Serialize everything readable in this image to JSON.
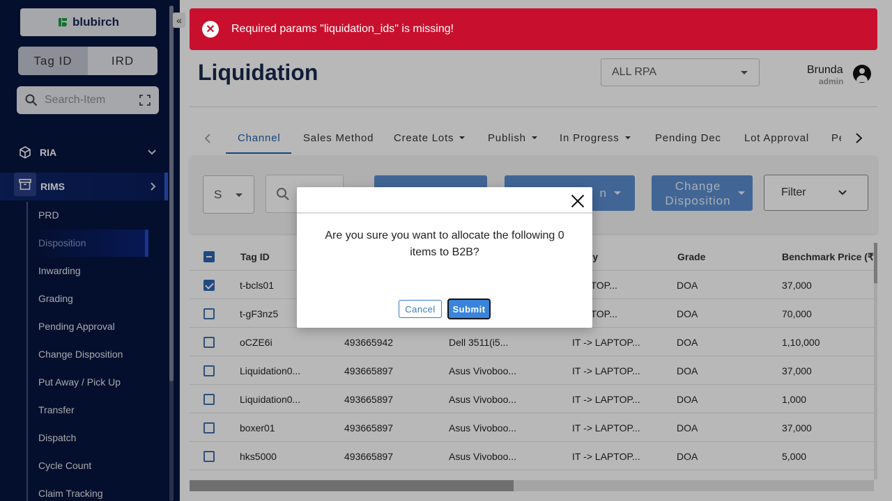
{
  "sidebar": {
    "logo_text": "blubirch",
    "toggle": {
      "option1": "Tag ID",
      "option2": "IRD"
    },
    "search_placeholder": "Search-Item",
    "sections": [
      {
        "label": "RIA"
      },
      {
        "label": "RIMS"
      }
    ],
    "sub_items": [
      "PRD",
      "Disposition",
      "Inwarding",
      "Grading",
      "Pending Approval",
      "Change Disposition",
      "Put Away / Pick Up",
      "Transfer",
      "Dispatch",
      "Cycle Count",
      "Claim Tracking"
    ],
    "active_item": "Disposition",
    "collapse_glyph": "«"
  },
  "alert": {
    "message": "Required params \"liquidation_ids\" is missing!",
    "icon": "error-circle-icon",
    "color": "#c8102e"
  },
  "header": {
    "title": "Liquidation",
    "rpa_select_value": "ALL RPA",
    "user_name": "Brunda",
    "user_role": "admin"
  },
  "tabs": {
    "items": [
      {
        "label": "Channel",
        "dropdown": false,
        "active": true
      },
      {
        "label": "Sales Method",
        "dropdown": false
      },
      {
        "label": "Create Lots",
        "dropdown": true
      },
      {
        "label": "Publish",
        "dropdown": true
      },
      {
        "label": "In Progress",
        "dropdown": true
      },
      {
        "label": "Pending Dec",
        "dropdown": false
      },
      {
        "label": "Lot Approval",
        "dropdown": false
      },
      {
        "label": "Pe",
        "dropdown": false
      }
    ]
  },
  "toolbar": {
    "select_value": "S",
    "search_value": "",
    "change_disposition_label": "Change Disposition",
    "partial_label": "n",
    "filter_label": "Filter"
  },
  "table": {
    "columns": [
      "Tag ID",
      "",
      "",
      "egory",
      "Grade",
      "Benchmark Price (₹"
    ],
    "rows": [
      {
        "checked": true,
        "tag_id": "t-bcls01",
        "col2": "",
        "col3": "",
        "category": "LAPTOP...",
        "grade": "DOA",
        "price": "37,000"
      },
      {
        "checked": false,
        "tag_id": "t-gF3nz5",
        "col2": "",
        "col3": "",
        "category": "LAPTOP...",
        "grade": "DOA",
        "price": "70,000"
      },
      {
        "checked": false,
        "tag_id": "oCZE6i",
        "col2": "493665942",
        "col3": "Dell 3511(i5...",
        "category": "IT -> LAPTOP...",
        "grade": "DOA",
        "price": "1,10,000"
      },
      {
        "checked": false,
        "tag_id": "Liquidation0...",
        "col2": "493665897",
        "col3": "Asus Vivoboo...",
        "category": "IT -> LAPTOP...",
        "grade": "DOA",
        "price": "37,000"
      },
      {
        "checked": false,
        "tag_id": "Liquidation0...",
        "col2": "493665897",
        "col3": "Asus Vivoboo...",
        "category": "IT -> LAPTOP...",
        "grade": "DOA",
        "price": "1,000"
      },
      {
        "checked": false,
        "tag_id": "boxer01",
        "col2": "493665897",
        "col3": "Asus Vivoboo...",
        "category": "IT -> LAPTOP...",
        "grade": "DOA",
        "price": "37,000"
      },
      {
        "checked": false,
        "tag_id": "hks5000",
        "col2": "493665897",
        "col3": "Asus Vivoboo...",
        "category": "IT -> LAPTOP...",
        "grade": "DOA",
        "price": "5,000"
      }
    ]
  },
  "modal": {
    "message": "Are you sure you want to allocate the following 0 items to B2B?",
    "cancel_label": "Cancel",
    "submit_label": "Submit"
  }
}
